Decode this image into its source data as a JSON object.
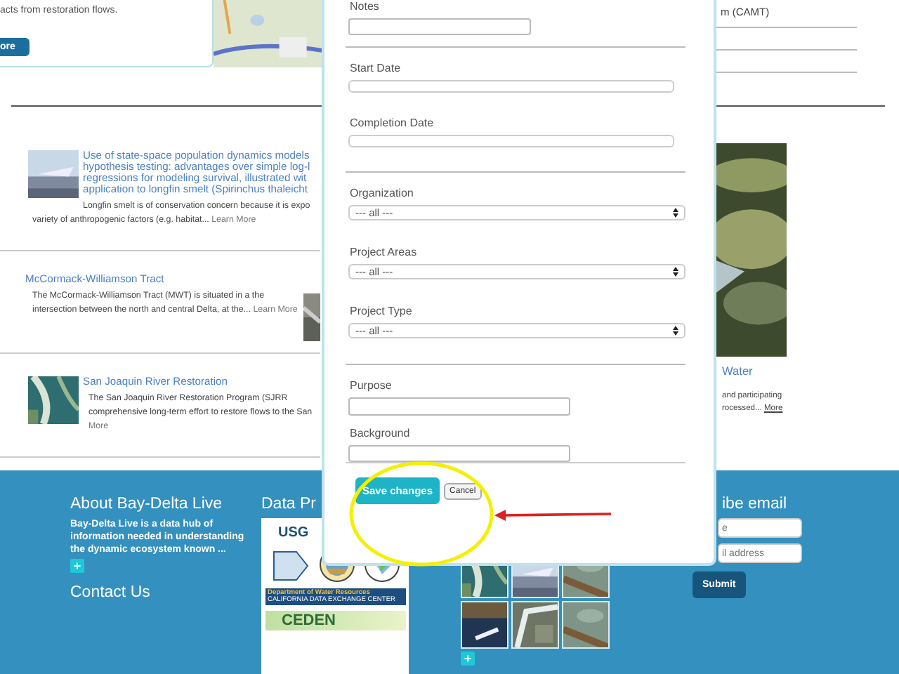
{
  "top_card": {
    "text": "acts from restoration flows.",
    "button": "ore"
  },
  "right_top": {
    "text": "m (CAMT)"
  },
  "articles": [
    {
      "kind": "thumb",
      "title": "Use of state-space population dynamics models\nhypothesis testing: advantages over simple log-l\nregressions for modeling survival, illustrated wit\napplication to longfin smelt (Spirinchus thaleicht",
      "summary": "Longfin smelt is of conservation concern because it is expo\nvariety of anthropogenic factors (e.g. habitat... ",
      "link": "Learn More"
    },
    {
      "kind": "side",
      "title": "McCormack-Williamson Tract",
      "summary": "The McCormack-Williamson Tract (MWT) is situated in a the\nintersection between the north and central Delta, at the... ",
      "link": "Learn More"
    },
    {
      "kind": "thumb",
      "title": "San Joaquin River Restoration",
      "summary": "The San Joaquin River Restoration Program (SJRR\ncomprehensive long-term effort to restore flows to the San\n",
      "link": "More"
    }
  ],
  "right_article": {
    "title": "Water",
    "summary": "and participating\nrocessed... ",
    "link": "More"
  },
  "modal": {
    "fields": [
      {
        "kind": "textarea",
        "label": "Notes"
      },
      {
        "kind": "divider"
      },
      {
        "kind": "input",
        "label": "Start Date"
      },
      {
        "kind": "input",
        "label": "Completion Date"
      },
      {
        "kind": "divider"
      },
      {
        "kind": "select",
        "label": "Organization",
        "value": "--- all ---"
      },
      {
        "kind": "select",
        "label": "Project Areas",
        "value": "--- all ---"
      },
      {
        "kind": "select",
        "label": "Project Type",
        "value": "--- all ---"
      },
      {
        "kind": "divider"
      },
      {
        "kind": "textarea",
        "label": "Purpose"
      },
      {
        "kind": "textarea",
        "label": "Background"
      }
    ],
    "save": "Save changes",
    "cancel": "Cancel"
  },
  "footer": {
    "about": {
      "title": "About Bay-Delta Live",
      "text": "Bay-Delta Live is a data hub of information needed in understanding the dynamic ecosystem known ...",
      "more": "+"
    },
    "contact": "Contact Us",
    "providers": {
      "title": "Data Pr",
      "logo_texts": [
        "USG",
        "Department of Water Resources",
        "CALIFORNIA DATA EXCHANGE CENTER",
        "CEDEN"
      ]
    },
    "photos_more": "+",
    "subscribe": {
      "title": "ibe email",
      "placeholders": [
        "e",
        "il address"
      ],
      "submit": "Submit"
    }
  }
}
